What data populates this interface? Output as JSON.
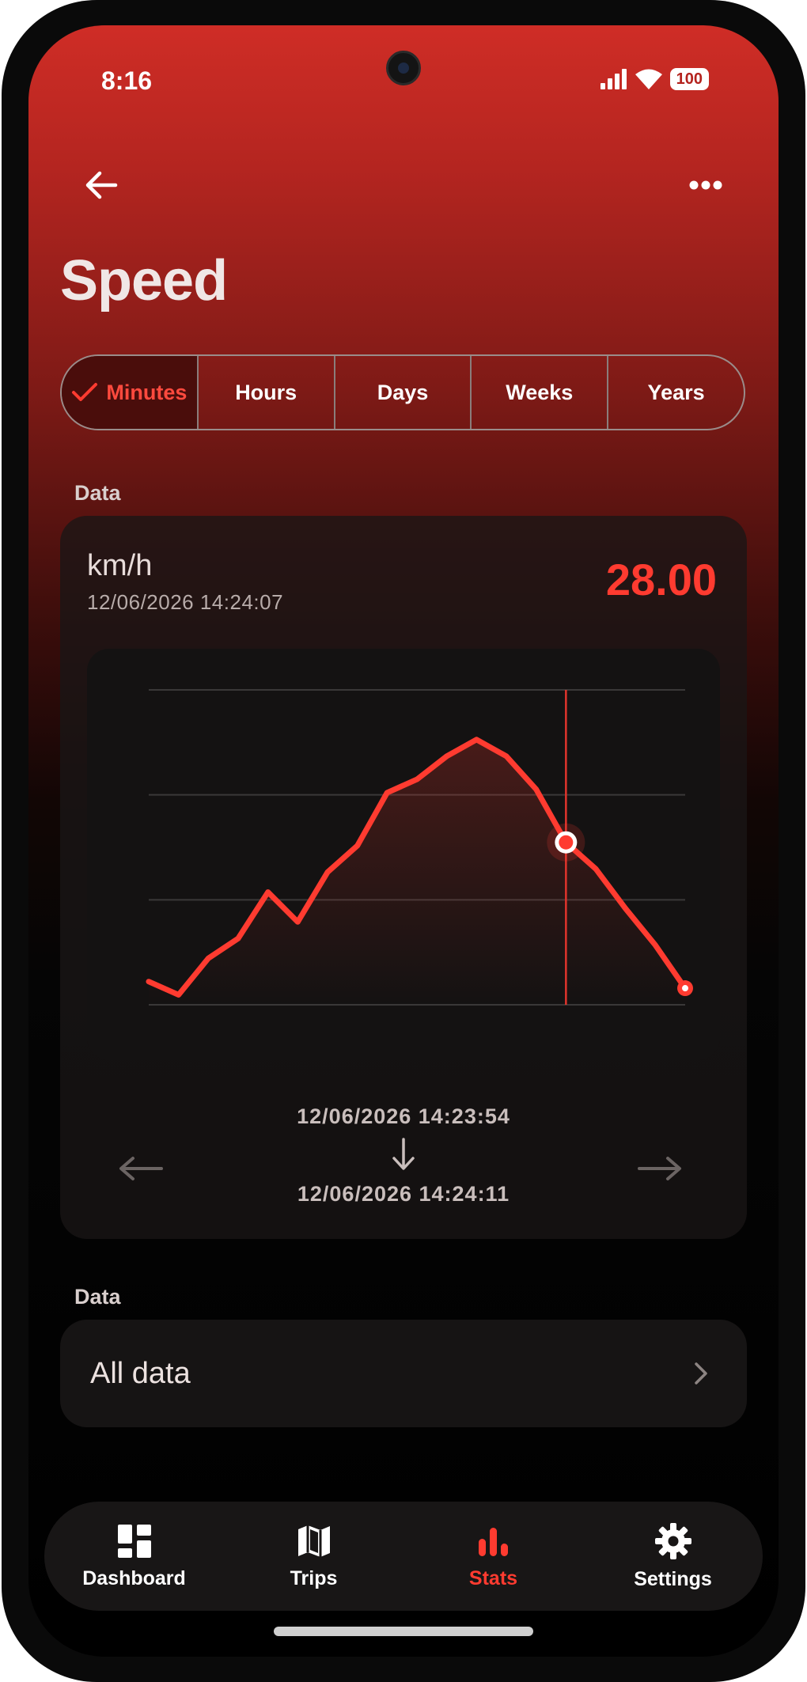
{
  "status_bar": {
    "time": "8:16",
    "battery": "100"
  },
  "header": {
    "title": "Speed",
    "back_icon": "arrow-left-icon",
    "more_icon": "more-horizontal-icon"
  },
  "tabs": [
    {
      "label": "Minutes",
      "active": true
    },
    {
      "label": "Hours",
      "active": false
    },
    {
      "label": "Days",
      "active": false
    },
    {
      "label": "Weeks",
      "active": false
    },
    {
      "label": "Years",
      "active": false
    }
  ],
  "data_section": {
    "label": "Data",
    "unit": "km/h",
    "timestamp": "12/06/2026 14:24:07",
    "current_value": "28.00"
  },
  "range": {
    "start": "12/06/2026 14:23:54",
    "end": "12/06/2026 14:24:11"
  },
  "chart_data": {
    "type": "line",
    "title": "",
    "xlabel": "",
    "ylabel": "",
    "grid": true,
    "values": [
      7,
      3,
      14,
      20,
      34,
      25,
      40,
      48,
      64,
      68,
      75,
      80,
      75,
      65,
      49,
      41,
      29,
      18,
      5
    ],
    "selected_index": 14,
    "ylim": [
      0,
      95
    ],
    "colors": {
      "line": "#ff3b30",
      "grid": "#3a3838",
      "cursor": "#e0342c"
    }
  },
  "all_data_section": {
    "label": "Data",
    "item_label": "All data"
  },
  "bottom_nav": [
    {
      "label": "Dashboard",
      "icon": "dashboard-icon",
      "active": false
    },
    {
      "label": "Trips",
      "icon": "map-icon",
      "active": false
    },
    {
      "label": "Stats",
      "icon": "bar-chart-icon",
      "active": true
    },
    {
      "label": "Settings",
      "icon": "gear-icon",
      "active": false
    }
  ],
  "colors": {
    "accent": "#ff3b30",
    "header_bg": "#cf2d26",
    "background": "#000000"
  }
}
